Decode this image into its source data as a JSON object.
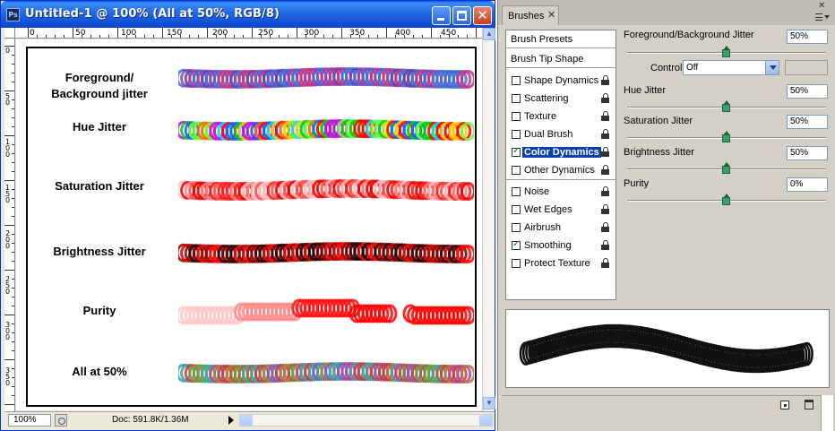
{
  "document": {
    "title": "Untitled-1 @ 100% (All at 50%, RGB/8)",
    "app_icon_text": "Ps",
    "ruler_h_labels": [
      "0",
      "50",
      "100",
      "150",
      "200",
      "250",
      "300",
      "350",
      "400",
      "450"
    ],
    "ruler_v_labels": [
      "0",
      "50",
      "100",
      "150",
      "200",
      "250",
      "300",
      "350",
      "4"
    ],
    "rows": [
      {
        "label": "Foreground/\nBackground jitter"
      },
      {
        "label": "Hue Jitter"
      },
      {
        "label": "Saturation Jitter"
      },
      {
        "label": "Brightness Jitter"
      },
      {
        "label": "Purity"
      },
      {
        "label": "All at 50%"
      }
    ],
    "status": {
      "zoom": "100%",
      "doc_info": "Doc: 591.8K/1.36M"
    }
  },
  "panel": {
    "tab_label": "Brushes",
    "tab_close": "✕",
    "close_glyph": "✕",
    "list": {
      "presets": "Brush Presets",
      "tip_shape": "Brush Tip Shape",
      "group1": [
        {
          "label": "Shape Dynamics",
          "checked": false,
          "selected": false
        },
        {
          "label": "Scattering",
          "checked": false,
          "selected": false
        },
        {
          "label": "Texture",
          "checked": false,
          "selected": false
        },
        {
          "label": "Dual Brush",
          "checked": false,
          "selected": false
        },
        {
          "label": "Color Dynamics",
          "checked": true,
          "selected": true
        },
        {
          "label": "Other Dynamics",
          "checked": false,
          "selected": false
        }
      ],
      "group2": [
        {
          "label": "Noise",
          "checked": false
        },
        {
          "label": "Wet Edges",
          "checked": false
        },
        {
          "label": "Airbrush",
          "checked": false
        },
        {
          "label": "Smoothing",
          "checked": true
        },
        {
          "label": "Protect Texture",
          "checked": false
        }
      ]
    },
    "controls": {
      "fg_bg": {
        "label": "Foreground/Background Jitter",
        "value": "50%",
        "level": 0.5
      },
      "control": {
        "label": "Control:",
        "value": "Off"
      },
      "hue": {
        "label": "Hue Jitter",
        "value": "50%",
        "level": 0.5
      },
      "saturation": {
        "label": "Saturation Jitter",
        "value": "50%",
        "level": 0.5
      },
      "brightness": {
        "label": "Brightness Jitter",
        "value": "50%",
        "level": 0.5
      },
      "purity": {
        "label": "Purity",
        "value": "0%",
        "level": 0.5
      }
    }
  },
  "colors": {
    "title_bar": "#2468e0",
    "selection": "#0a3fb4",
    "slider_thumb": "#3aa06a"
  }
}
